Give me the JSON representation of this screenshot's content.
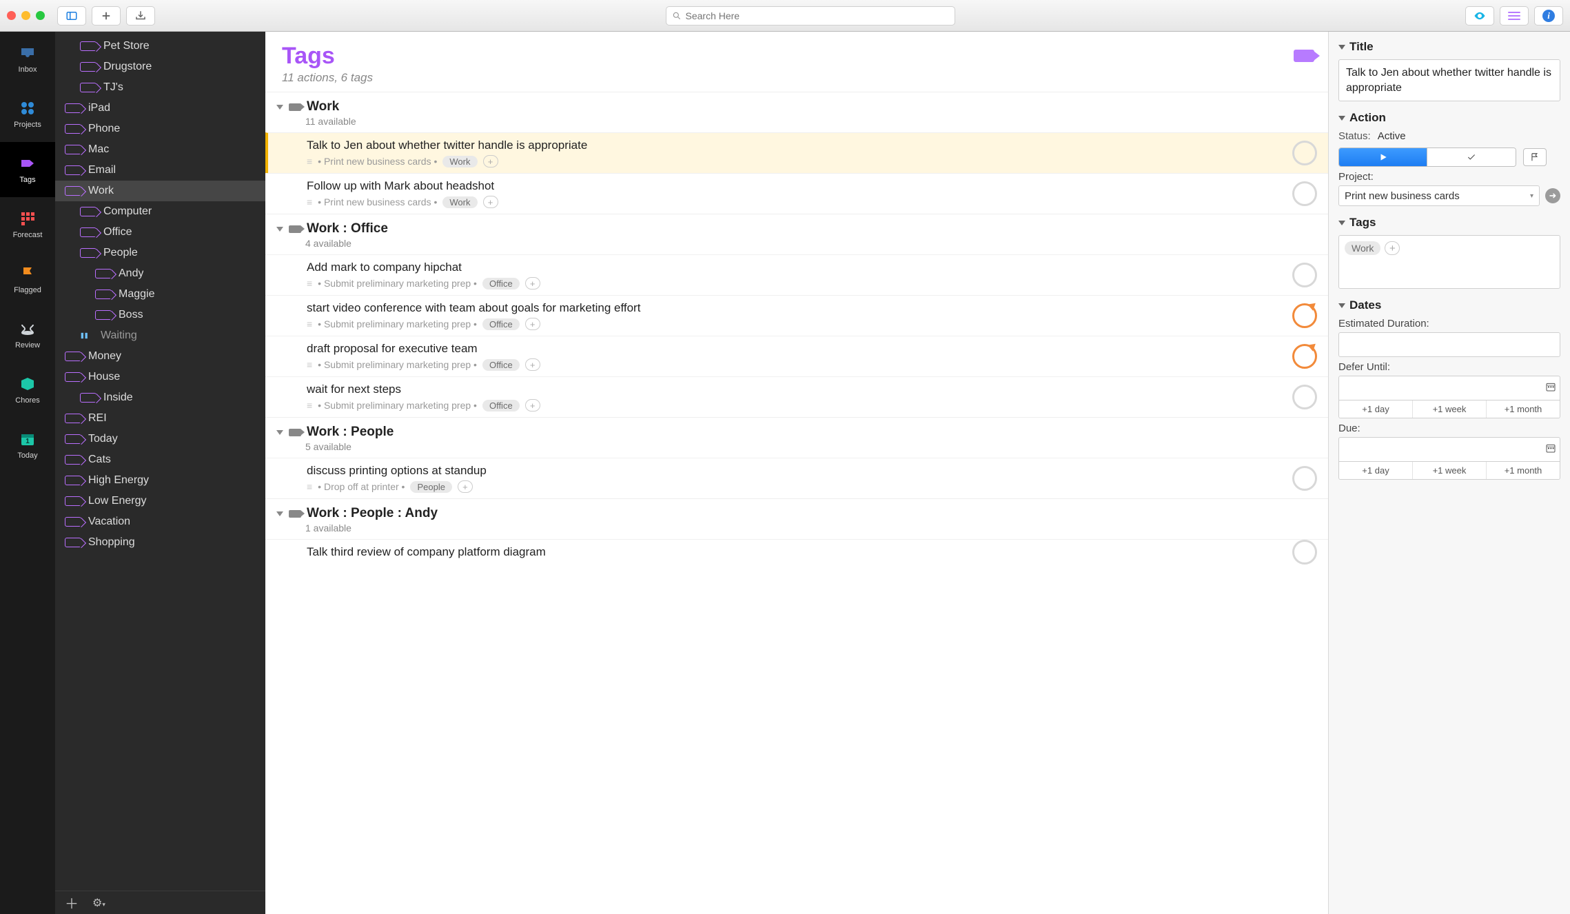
{
  "toolbar": {
    "search_placeholder": "Search Here"
  },
  "rail": [
    {
      "id": "inbox",
      "label": "Inbox"
    },
    {
      "id": "projects",
      "label": "Projects"
    },
    {
      "id": "tags",
      "label": "Tags",
      "active": true
    },
    {
      "id": "forecast",
      "label": "Forecast"
    },
    {
      "id": "flagged",
      "label": "Flagged"
    },
    {
      "id": "review",
      "label": "Review"
    },
    {
      "id": "chores",
      "label": "Chores"
    },
    {
      "id": "today",
      "label": "Today"
    }
  ],
  "taglist": [
    {
      "label": "Pet Store",
      "depth": 1
    },
    {
      "label": "Drugstore",
      "depth": 1
    },
    {
      "label": "TJ's",
      "depth": 1
    },
    {
      "label": "iPad",
      "depth": 0
    },
    {
      "label": "Phone",
      "depth": 0
    },
    {
      "label": "Mac",
      "depth": 0
    },
    {
      "label": "Email",
      "depth": 0
    },
    {
      "label": "Work",
      "depth": 0,
      "selected": true
    },
    {
      "label": "Computer",
      "depth": 1
    },
    {
      "label": "Office",
      "depth": 1
    },
    {
      "label": "People",
      "depth": 1
    },
    {
      "label": "Andy",
      "depth": 2
    },
    {
      "label": "Maggie",
      "depth": 2
    },
    {
      "label": "Boss",
      "depth": 2
    },
    {
      "label": "Waiting",
      "depth": 1,
      "waiting": true
    },
    {
      "label": "Money",
      "depth": 0
    },
    {
      "label": "House",
      "depth": 0
    },
    {
      "label": "Inside",
      "depth": 1
    },
    {
      "label": "REI",
      "depth": 0
    },
    {
      "label": "Today",
      "depth": 0
    },
    {
      "label": "Cats",
      "depth": 0
    },
    {
      "label": "High Energy",
      "depth": 0
    },
    {
      "label": "Low Energy",
      "depth": 0
    },
    {
      "label": "Vacation",
      "depth": 0
    },
    {
      "label": "Shopping",
      "depth": 0
    }
  ],
  "content": {
    "title": "Tags",
    "subtitle": "11 actions, 6 tags",
    "sections": [
      {
        "title": "Work",
        "subtitle": "11 available",
        "tasks": [
          {
            "title": "Talk to Jen about whether twitter handle is appropriate",
            "project": "Print new business cards",
            "tag": "Work",
            "selected": true,
            "repeat": false
          },
          {
            "title": "Follow up with Mark about headshot",
            "project": "Print new business cards",
            "tag": "Work",
            "repeat": false
          }
        ]
      },
      {
        "title": "Work : Office",
        "subtitle": "4 available",
        "tasks": [
          {
            "title": "Add mark to company hipchat",
            "project": "Submit preliminary marketing prep",
            "tag": "Office",
            "repeat": false
          },
          {
            "title": "start video conference with team about goals for marketing effort",
            "project": "Submit preliminary marketing prep",
            "tag": "Office",
            "repeat": true
          },
          {
            "title": "draft proposal for executive team",
            "project": "Submit preliminary marketing prep",
            "tag": "Office",
            "repeat": true
          },
          {
            "title": "wait for next steps",
            "project": "Submit preliminary marketing prep",
            "tag": "Office",
            "repeat": false
          }
        ]
      },
      {
        "title": "Work : People",
        "subtitle": "5 available",
        "tasks": [
          {
            "title": "discuss printing options at standup",
            "project": "Drop off at printer",
            "tag": "People",
            "repeat": false
          }
        ]
      },
      {
        "title": "Work : People : Andy",
        "subtitle": "1 available",
        "tasks": [
          {
            "title": "Talk third review of company platform diagram",
            "project": "",
            "tag": "",
            "repeat": false,
            "nometa": true
          }
        ]
      }
    ]
  },
  "inspector": {
    "title_hdr": "Title",
    "title_value": "Talk to Jen about whether twitter handle is appropriate",
    "action_hdr": "Action",
    "status_label": "Status:",
    "status_value": "Active",
    "project_label": "Project:",
    "project_value": "Print new business cards",
    "tags_hdr": "Tags",
    "tag_chip": "Work",
    "dates_hdr": "Dates",
    "est_label": "Estimated Duration:",
    "defer_label": "Defer Until:",
    "due_label": "Due:",
    "quick": {
      "d1": "+1 day",
      "w1": "+1 week",
      "m1": "+1 month"
    }
  }
}
